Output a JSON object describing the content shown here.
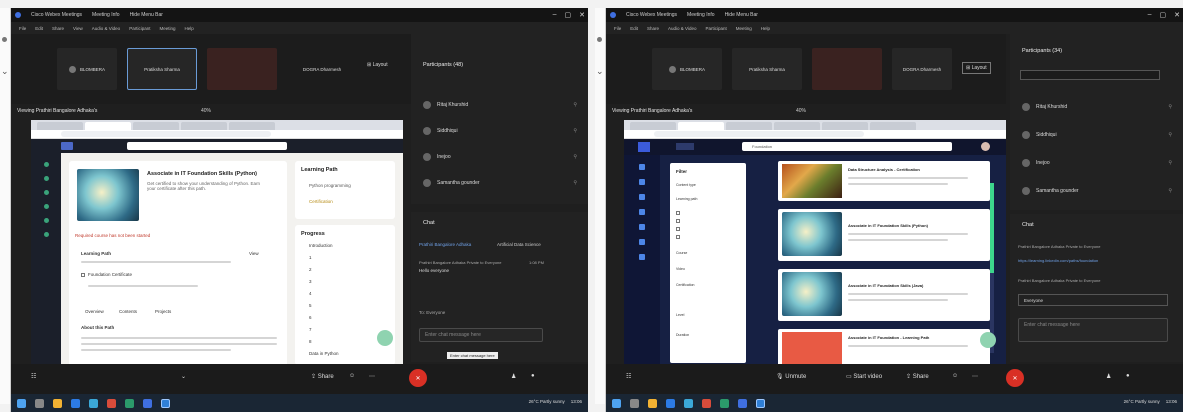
{
  "left": {
    "title_bar": {
      "app_title": "Cisco Webex Meetings",
      "tabs": [
        "Meeting Info",
        "Hide Menu Bar"
      ],
      "status_badge": "",
      "window_controls": [
        "–",
        "▢",
        "✕"
      ]
    },
    "menu": [
      "File",
      "Edit",
      "Share",
      "View",
      "Audio & Video",
      "Participant",
      "Meeting",
      "Help"
    ],
    "strip_tiles": [
      {
        "name": "BLOMBERA",
        "sub": "",
        "kind": "normal"
      },
      {
        "name": "Pratiksha Sharma",
        "sub": "",
        "kind": "selected"
      },
      {
        "name": "",
        "sub": "",
        "kind": "camera"
      },
      {
        "name": "DOGRA Dharmesh",
        "sub": "",
        "kind": "plain"
      }
    ],
    "layout_label": "Layout",
    "viewing_text": "Viewing Prathiri Bangalore Adhaka's",
    "zoom_text": "40%",
    "share": {
      "course_title": "Associate in IT Foundation Skills (Python)",
      "course_desc": "Get certified to show your understanding of Python. Earn your certificate after this path.",
      "alert_text": "Required course has not been started",
      "section_label": "Learning Path",
      "view_label": "View",
      "checkbox_label": "Foundation Certificate",
      "tabs": [
        "Overview",
        "Contents",
        "Projects"
      ],
      "about_heading": "About this Path",
      "side_heading": "Learning Path",
      "side_items": [
        "Python programming",
        "Certification"
      ],
      "progress_heading": "Progress",
      "progress_items": [
        "Introduction",
        "1",
        "2",
        "3",
        "4",
        "5",
        "6",
        "7",
        "8",
        "Data in Python"
      ]
    },
    "participants": {
      "heading": "Participants (48)",
      "rows": [
        "Ritaj Khurshid",
        "Siddhiqui",
        "Inejoo",
        "Samantha gounder"
      ]
    },
    "chat": {
      "heading": "Chat",
      "msg1_from": "Prathiri Bangalore Adhaka",
      "msg1_to": "Artificial Data Science",
      "msg2": "Prathiri Bangalore Adhaka Private to Everyone",
      "msg2_time": "1:08 PM",
      "msg3": "Hello everyone",
      "to_label": "To: Everyone",
      "placeholder": "Enter chat message here",
      "tooltip": "Enter chat message here"
    },
    "controls": {
      "share_label": "Share",
      "leave_label": "✕"
    }
  },
  "right": {
    "title_bar": {
      "app_title": "Cisco Webex Meetings",
      "tabs": [
        "Meeting Info",
        "Hide Menu Bar"
      ],
      "status_badge": "",
      "window_controls": [
        "–",
        "▢",
        "✕"
      ]
    },
    "menu": [
      "File",
      "Edit",
      "Share",
      "Audio & Video",
      "Participant",
      "Meeting",
      "Help"
    ],
    "strip_tiles": [
      {
        "name": "BLOMBERA",
        "sub": "",
        "kind": "normal"
      },
      {
        "name": "Pratiksha Sharma",
        "sub": "",
        "kind": "normal"
      },
      {
        "name": "",
        "sub": "",
        "kind": "camera"
      },
      {
        "name": "DOGRA Dharmesh",
        "sub": "",
        "kind": "plain"
      }
    ],
    "layout_label": "Layout",
    "viewing_text": "Viewing Prathiri Bangalore Adhaka's",
    "zoom_text": "40%",
    "share": {
      "search_text": "Foundation",
      "filters_heading": "Filter",
      "filter_items": [
        "Content type",
        "Learning path",
        "Course",
        "Video",
        "Certification",
        "Level",
        "Duration"
      ],
      "results": [
        {
          "title": "Data Structure Analysis - Certification",
          "thumb": "food"
        },
        {
          "title": "Associate in IT Foundation Skills (Python)",
          "thumb": "dandelion"
        },
        {
          "title": "Associate in IT Foundation Skills (Java)",
          "thumb": "dandelion"
        },
        {
          "title": "Associate in IT Foundation - Learning Path",
          "thumb": "orange"
        }
      ]
    },
    "participants": {
      "heading": "Participants (34)",
      "rows": [
        "Ritaj Khurshid",
        "Siddhiqui",
        "Inejoo",
        "Samantha gounder"
      ]
    },
    "chat": {
      "heading": "Chat",
      "msg1": "Prathiri Bangalore Adhaka Private to Everyone",
      "msg1_link": "https://learning.linkedin.com/paths/foundation",
      "msg2": "Prathiri Bangalore Adhaka Private to Everyone",
      "to_label": "Everyone",
      "placeholder": "Enter chat message here"
    },
    "controls": {
      "mute_label": "Unmute",
      "video_label": "Start video",
      "share_label": "Share"
    }
  },
  "taskbar": {
    "weather": "26°C Partly sunny",
    "time": "13:06"
  }
}
